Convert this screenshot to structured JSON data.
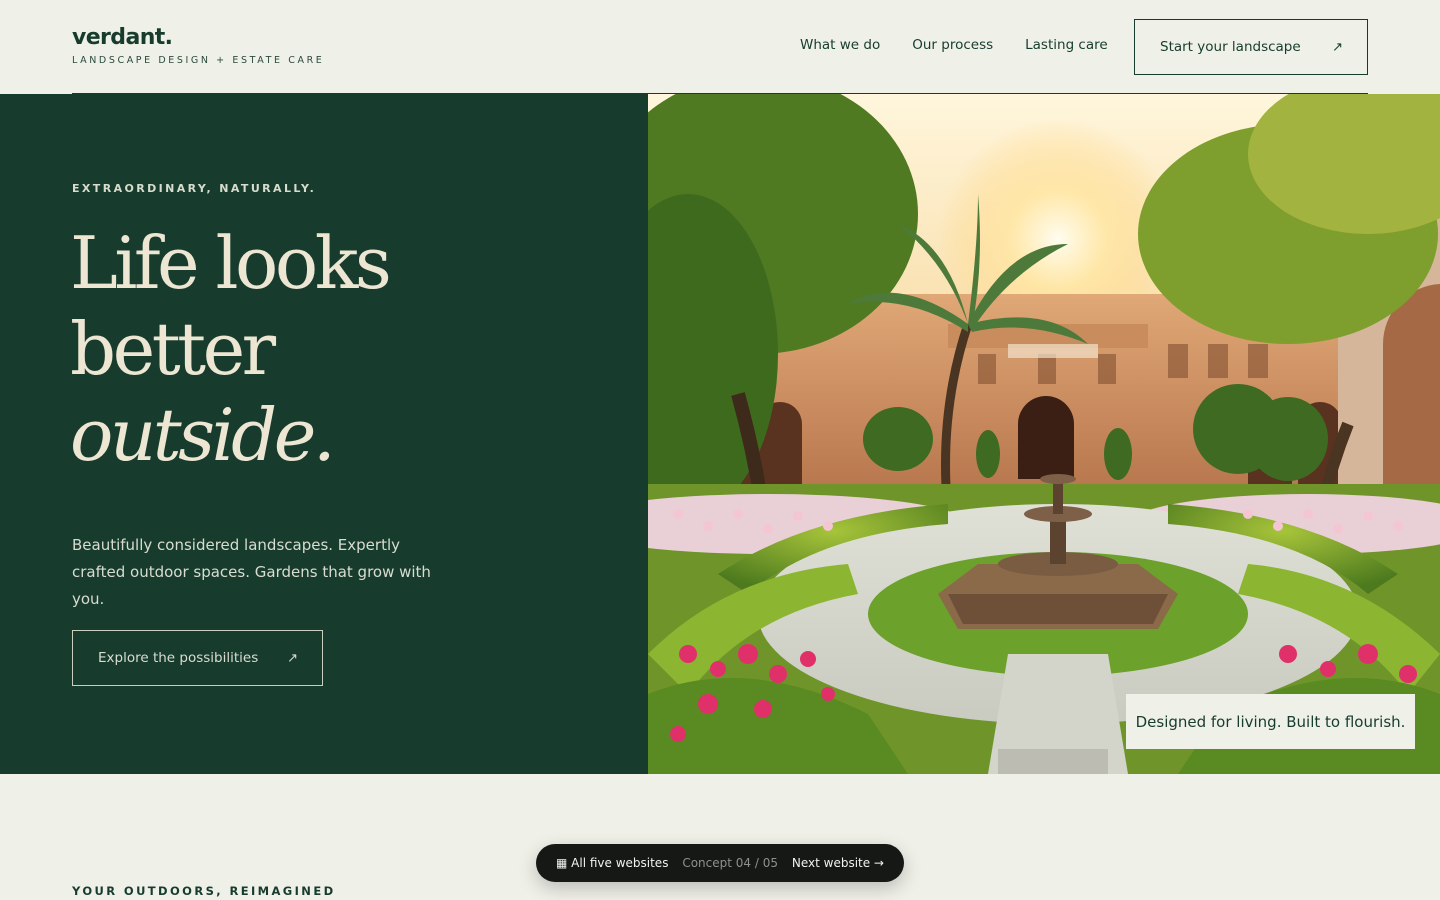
{
  "brand": {
    "name": "verdant.",
    "tagline": "LANDSCAPE DESIGN + ESTATE CARE"
  },
  "nav": {
    "items": [
      {
        "label": "What we do"
      },
      {
        "label": "Our process"
      },
      {
        "label": "Lasting care"
      }
    ],
    "cta_label": "Start your landscape",
    "cta_icon": "arrow-up-right-icon"
  },
  "hero": {
    "eyebrow": "EXTRAORDINARY, NATURALLY.",
    "headline_line1": "Life looks",
    "headline_line2": "better",
    "headline_line3": "outside.",
    "copy": "Beautifully considered landscapes. Expertly crafted outdoor spaces. Gardens that grow with you.",
    "cta_label": "Explore the possibilities",
    "image_caption": "Designed for living. Built to flourish."
  },
  "section": {
    "eyebrow": "YOUR OUTDOORS, REIMAGINED"
  },
  "switcher": {
    "all_label": "▦ All five websites",
    "concept_label": "Concept 04 / 05",
    "next_label": "Next website →"
  },
  "colors": {
    "forest": "#173c2e",
    "cream_bg": "#eff0e8",
    "headline_cream": "#ece6d3",
    "pill_bg": "#161816"
  }
}
